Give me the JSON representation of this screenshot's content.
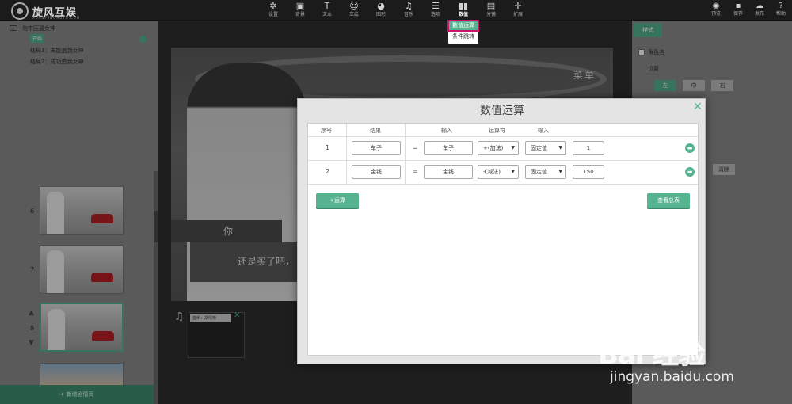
{
  "app": {
    "logo_text": "旋风互娱",
    "logo_sub": "XUANFENGHUYU.COM"
  },
  "toolbar": {
    "items": [
      {
        "label": "设置",
        "icon": "gear-icon"
      },
      {
        "label": "背景",
        "icon": "image-icon"
      },
      {
        "label": "文本",
        "icon": "text-icon"
      },
      {
        "label": "立绘",
        "icon": "person-icon"
      },
      {
        "label": "图形",
        "icon": "pie-icon"
      },
      {
        "label": "音乐",
        "icon": "music-icon"
      },
      {
        "label": "选项",
        "icon": "list-icon"
      },
      {
        "label": "数值",
        "icon": "bar-chart-icon"
      },
      {
        "label": "分镜",
        "icon": "film-icon"
      },
      {
        "label": "扩展",
        "icon": "cross-icon"
      }
    ],
    "right_items": [
      {
        "label": "预览",
        "icon": "eye-icon"
      },
      {
        "label": "保存",
        "icon": "save-icon"
      },
      {
        "label": "发布",
        "icon": "cloud-icon"
      },
      {
        "label": "帮助",
        "icon": "help-icon"
      }
    ]
  },
  "submenu": {
    "items": [
      "数值运算",
      "条件跳转"
    ]
  },
  "left_panel": {
    "story_title": "勿带压逼女神",
    "start_tag": "开始",
    "endings": [
      "结局1：未能追到女神",
      "结局2：成功追到女神"
    ],
    "scenes": [
      "6",
      "7",
      "8"
    ],
    "add_scene_label": "+ 新增剧情页"
  },
  "stage": {
    "menu_label": "菜单",
    "speaker": "你",
    "dialog": "还是买了吧，",
    "music_tag": "音乐：胡玛特"
  },
  "right_panel": {
    "tab_label": "样式",
    "checkbox_label": "角色名",
    "position_label": "位置",
    "position_options": [
      "左",
      "中",
      "右"
    ],
    "clear_label": "清除"
  },
  "modal": {
    "title": "数值运算",
    "headers": [
      "序号",
      "结果",
      "输入",
      "运算符",
      "输入"
    ],
    "rows": [
      {
        "index": "1",
        "result": "车子",
        "equals": "=",
        "input1": "车子",
        "operator": "+(加法)",
        "type": "固定值",
        "value": "1"
      },
      {
        "index": "2",
        "result": "金钱",
        "equals": "=",
        "input1": "金钱",
        "operator": "-(减法)",
        "type": "固定值",
        "value": "150"
      }
    ],
    "add_button": "+运算",
    "view_button": "查看总表"
  },
  "watermark": {
    "brand": "Bai 经验",
    "url": "jingyan.baidu.com"
  }
}
